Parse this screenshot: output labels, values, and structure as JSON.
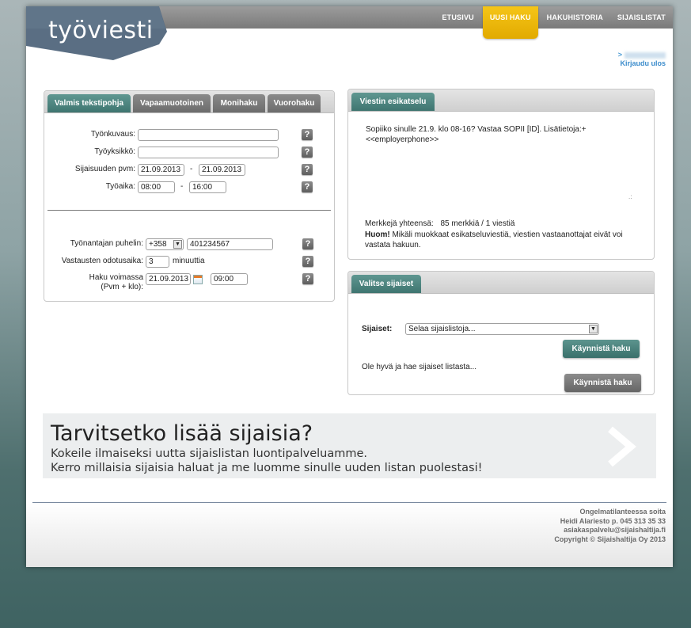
{
  "logo": {
    "text": "työviesti"
  },
  "nav": {
    "items": [
      {
        "label": "ETUSIVU"
      },
      {
        "label": "UUSI HAKU"
      },
      {
        "label": "HAKUHISTORIA"
      },
      {
        "label": "SIJAISLISTAT"
      }
    ],
    "active_index": 1
  },
  "user": {
    "prefix": ">",
    "logout": "Kirjaudu ulos"
  },
  "left_panel": {
    "tabs": [
      "Valmis tekstipohja",
      "Vapaamuotoinen",
      "Monihaku",
      "Vuorohaku"
    ],
    "labels": {
      "job_desc": "Työnkuvaus:",
      "work_unit": "Työyksikkö:",
      "dates": "Sijaisuuden pvm:",
      "work_time": "Työaika:",
      "phone": "Työnantajan puhelin:",
      "wait": "Vastausten odotusaika:",
      "wait_unit": "minuuttia",
      "valid_line1": "Haku voimassa",
      "valid_line2": "(Pvm + klo):"
    },
    "values": {
      "job_desc": "",
      "work_unit": "",
      "date_from": "21.09.2013",
      "date_to": "21.09.2013",
      "time_from": "08:00",
      "time_to": "16:00",
      "phone_prefix": "+358",
      "phone_number": "401234567",
      "wait": "3",
      "valid_date": "21.09.2013",
      "valid_time": "09:00"
    },
    "dash": "-",
    "help": "?"
  },
  "preview_panel": {
    "tab": "Viestin esikatselu",
    "message_line1": "Sopiiko sinulle   21.9.  klo 08-16? Vastaa SOPII [ID]. Lisätietoja:+",
    "message_line2": "<<employerphone>>",
    "count_label": "Merkkejä yhteensä:",
    "count_value": "85 merkkiä / 1 viestiä",
    "note_bold": "Huom!",
    "note_text": " Mikäli muokkaat esikatseluviestiä, viestien vastaanottajat eivät voi",
    "note_text2": "vastata hakuun."
  },
  "select_panel": {
    "tab": "Valitse sijaiset",
    "label": "Sijaiset:",
    "select_value": "Selaa sijaislistoja...",
    "start_button": "Käynnistä haku",
    "hint": "Ole hyvä ja hae sijaiset listasta...",
    "start_button_disabled": "Käynnistä haku"
  },
  "banner": {
    "title": "Tarvitsetko lisää sijaisia?",
    "line1": "Kokeile ilmaiseksi uutta sijaislistan luontipalveluamme.",
    "line2": "Kerro millaisia sijaisia haluat ja me luomme sinulle uuden listan puolestasi!"
  },
  "footer": {
    "line1": "Ongelmatilanteessa soita",
    "line2": "Heidi Alariesto p. 045 313 35 33",
    "line3": "asiakaspalvelu@sijaishaltija.fi",
    "line4": "Copyright © Sijaishaltija Oy 2013"
  },
  "colors": {
    "accent_teal": "#3f7570",
    "nav_active": "#f0bb10",
    "link": "#3b8ccc"
  }
}
